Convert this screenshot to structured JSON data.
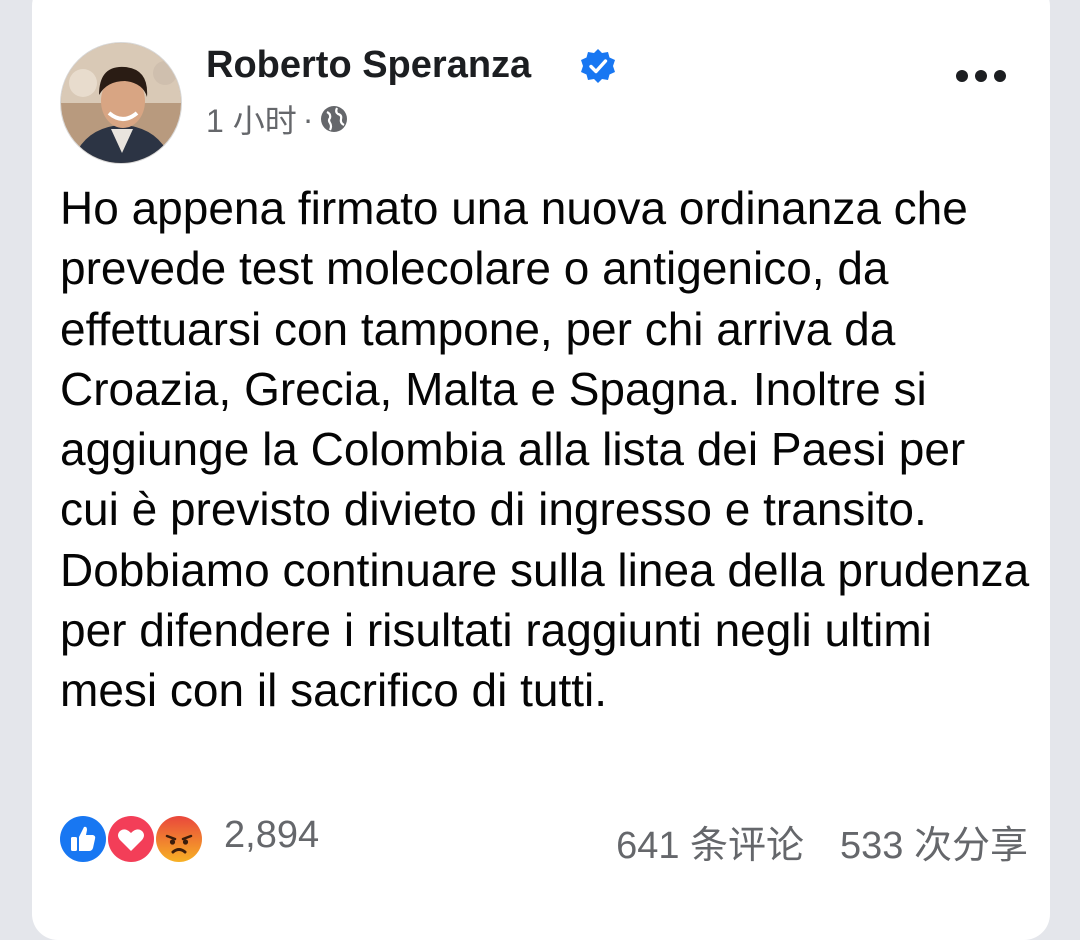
{
  "post": {
    "author_name": "Roberto Speranza",
    "verified_icon": "verified-badge-icon",
    "time": "1 小时",
    "separator": "·",
    "audience_icon": "globe-icon",
    "more_icon": "more-options-icon",
    "body_paragraphs": [
      "Ho appena firmato una nuova ordinanza che prevede test molecolare o antigenico, da effettuarsi con tampone, per chi arriva da Croazia, Grecia, Malta e Spagna. Inoltre si aggiunge la Colombia alla lista dei Paesi per cui è previsto divieto di ingresso e transito.",
      "Dobbiamo continuare sulla linea della prudenza per difendere i risultati raggiunti negli ultimi mesi con il sacrifico di tutti."
    ]
  },
  "engagement": {
    "reactions": [
      "like-reaction-icon",
      "love-reaction-icon",
      "angry-reaction-icon"
    ],
    "reaction_count": "2,894",
    "comments": "641 条评论",
    "shares": "533 次分享"
  },
  "colors": {
    "background": "#e4e6eb",
    "card": "#ffffff",
    "text_primary": "#050505",
    "text_secondary": "#65676b",
    "verified_blue": "#1877f2",
    "like_blue": "#1877f2",
    "love_red": "#f33e58",
    "angry_orange": "#f7714c"
  }
}
